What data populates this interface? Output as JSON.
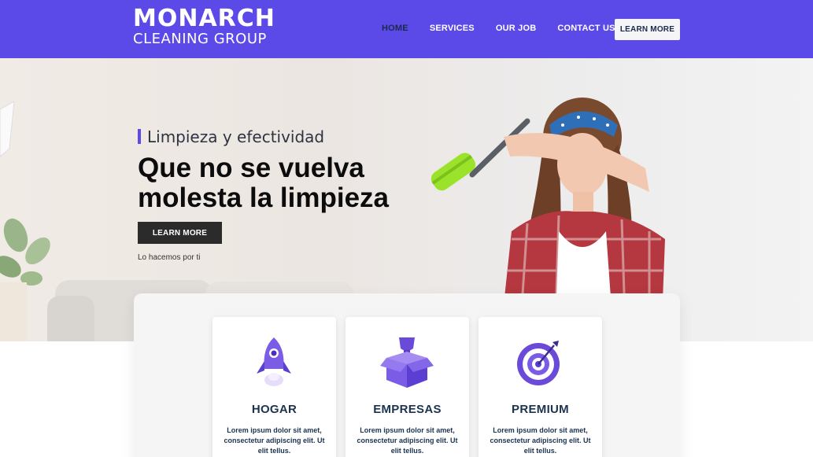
{
  "header": {
    "logo_main": "MONARCH",
    "logo_sub": "CLEANING GROUP",
    "nav": [
      "HOME",
      "SERVICES",
      "OUR JOB",
      "CONTACT US"
    ],
    "cta": "LEARN MORE"
  },
  "hero": {
    "tagline": "Limpieza y efectividad",
    "headline_line1": "Que no se vuelva",
    "headline_line2": "molesta la limpieza",
    "button": "LEARN MORE",
    "note": "Lo hacemos por ti"
  },
  "services": [
    {
      "icon": "rocket-icon",
      "title": "HOGAR",
      "desc": "Lorem ipsum dolor sit amet, consectetur adipiscing elit. Ut elit tellus."
    },
    {
      "icon": "box-trophy-icon",
      "title": "EMPRESAS",
      "desc": "Lorem ipsum dolor sit amet, consectetur adipiscing elit. Ut elit tellus."
    },
    {
      "icon": "target-icon",
      "title": "PREMIUM",
      "desc": "Lorem ipsum dolor sit amet, consectetur adipiscing elit. Ut elit tellus."
    }
  ],
  "colors": {
    "brand": "#5b4ae8",
    "dark_text": "#1c3350",
    "button_dark": "#2b2b2b"
  }
}
